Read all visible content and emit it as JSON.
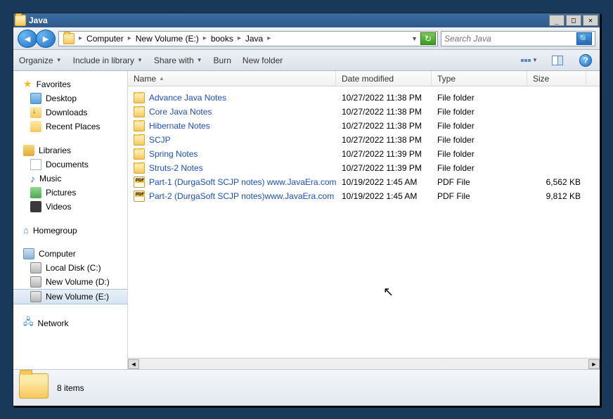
{
  "title": "Java",
  "breadcrumb": [
    "Computer",
    "New Volume (E:)",
    "books",
    "Java"
  ],
  "search": {
    "placeholder": "Search Java"
  },
  "toolbar": {
    "organize": "Organize",
    "include": "Include in library",
    "share": "Share with",
    "burn": "Burn",
    "newfolder": "New folder"
  },
  "columns": {
    "name": "Name",
    "date": "Date modified",
    "type": "Type",
    "size": "Size"
  },
  "nav": {
    "favorites": "Favorites",
    "desktop": "Desktop",
    "downloads": "Downloads",
    "recent": "Recent Places",
    "libraries": "Libraries",
    "documents": "Documents",
    "music": "Music",
    "pictures": "Pictures",
    "videos": "Videos",
    "homegroup": "Homegroup",
    "computer": "Computer",
    "localc": "Local Disk (C:)",
    "vold": "New Volume (D:)",
    "vole": "New Volume (E:)",
    "network": "Network"
  },
  "files": [
    {
      "name": "Advance Java Notes",
      "date": "10/27/2022 11:38 PM",
      "type": "File folder",
      "size": "",
      "kind": "folder"
    },
    {
      "name": "Core Java Notes",
      "date": "10/27/2022 11:38 PM",
      "type": "File folder",
      "size": "",
      "kind": "folder"
    },
    {
      "name": "Hibernate Notes",
      "date": "10/27/2022 11:38 PM",
      "type": "File folder",
      "size": "",
      "kind": "folder"
    },
    {
      "name": "SCJP",
      "date": "10/27/2022 11:38 PM",
      "type": "File folder",
      "size": "",
      "kind": "folder"
    },
    {
      "name": "Spring Notes",
      "date": "10/27/2022 11:39 PM",
      "type": "File folder",
      "size": "",
      "kind": "folder"
    },
    {
      "name": "Struts-2 Notes",
      "date": "10/27/2022 11:39 PM",
      "type": "File folder",
      "size": "",
      "kind": "folder"
    },
    {
      "name": "Part-1 (DurgaSoft SCJP notes) www.JavaEra.com",
      "date": "10/19/2022 1:45 AM",
      "type": "PDF File",
      "size": "6,562 KB",
      "kind": "pdf"
    },
    {
      "name": "Part-2 (DurgaSoft SCJP notes)www.JavaEra.com",
      "date": "10/19/2022 1:45 AM",
      "type": "PDF File",
      "size": "9,812 KB",
      "kind": "pdf"
    }
  ],
  "status": {
    "count": "8 items"
  }
}
